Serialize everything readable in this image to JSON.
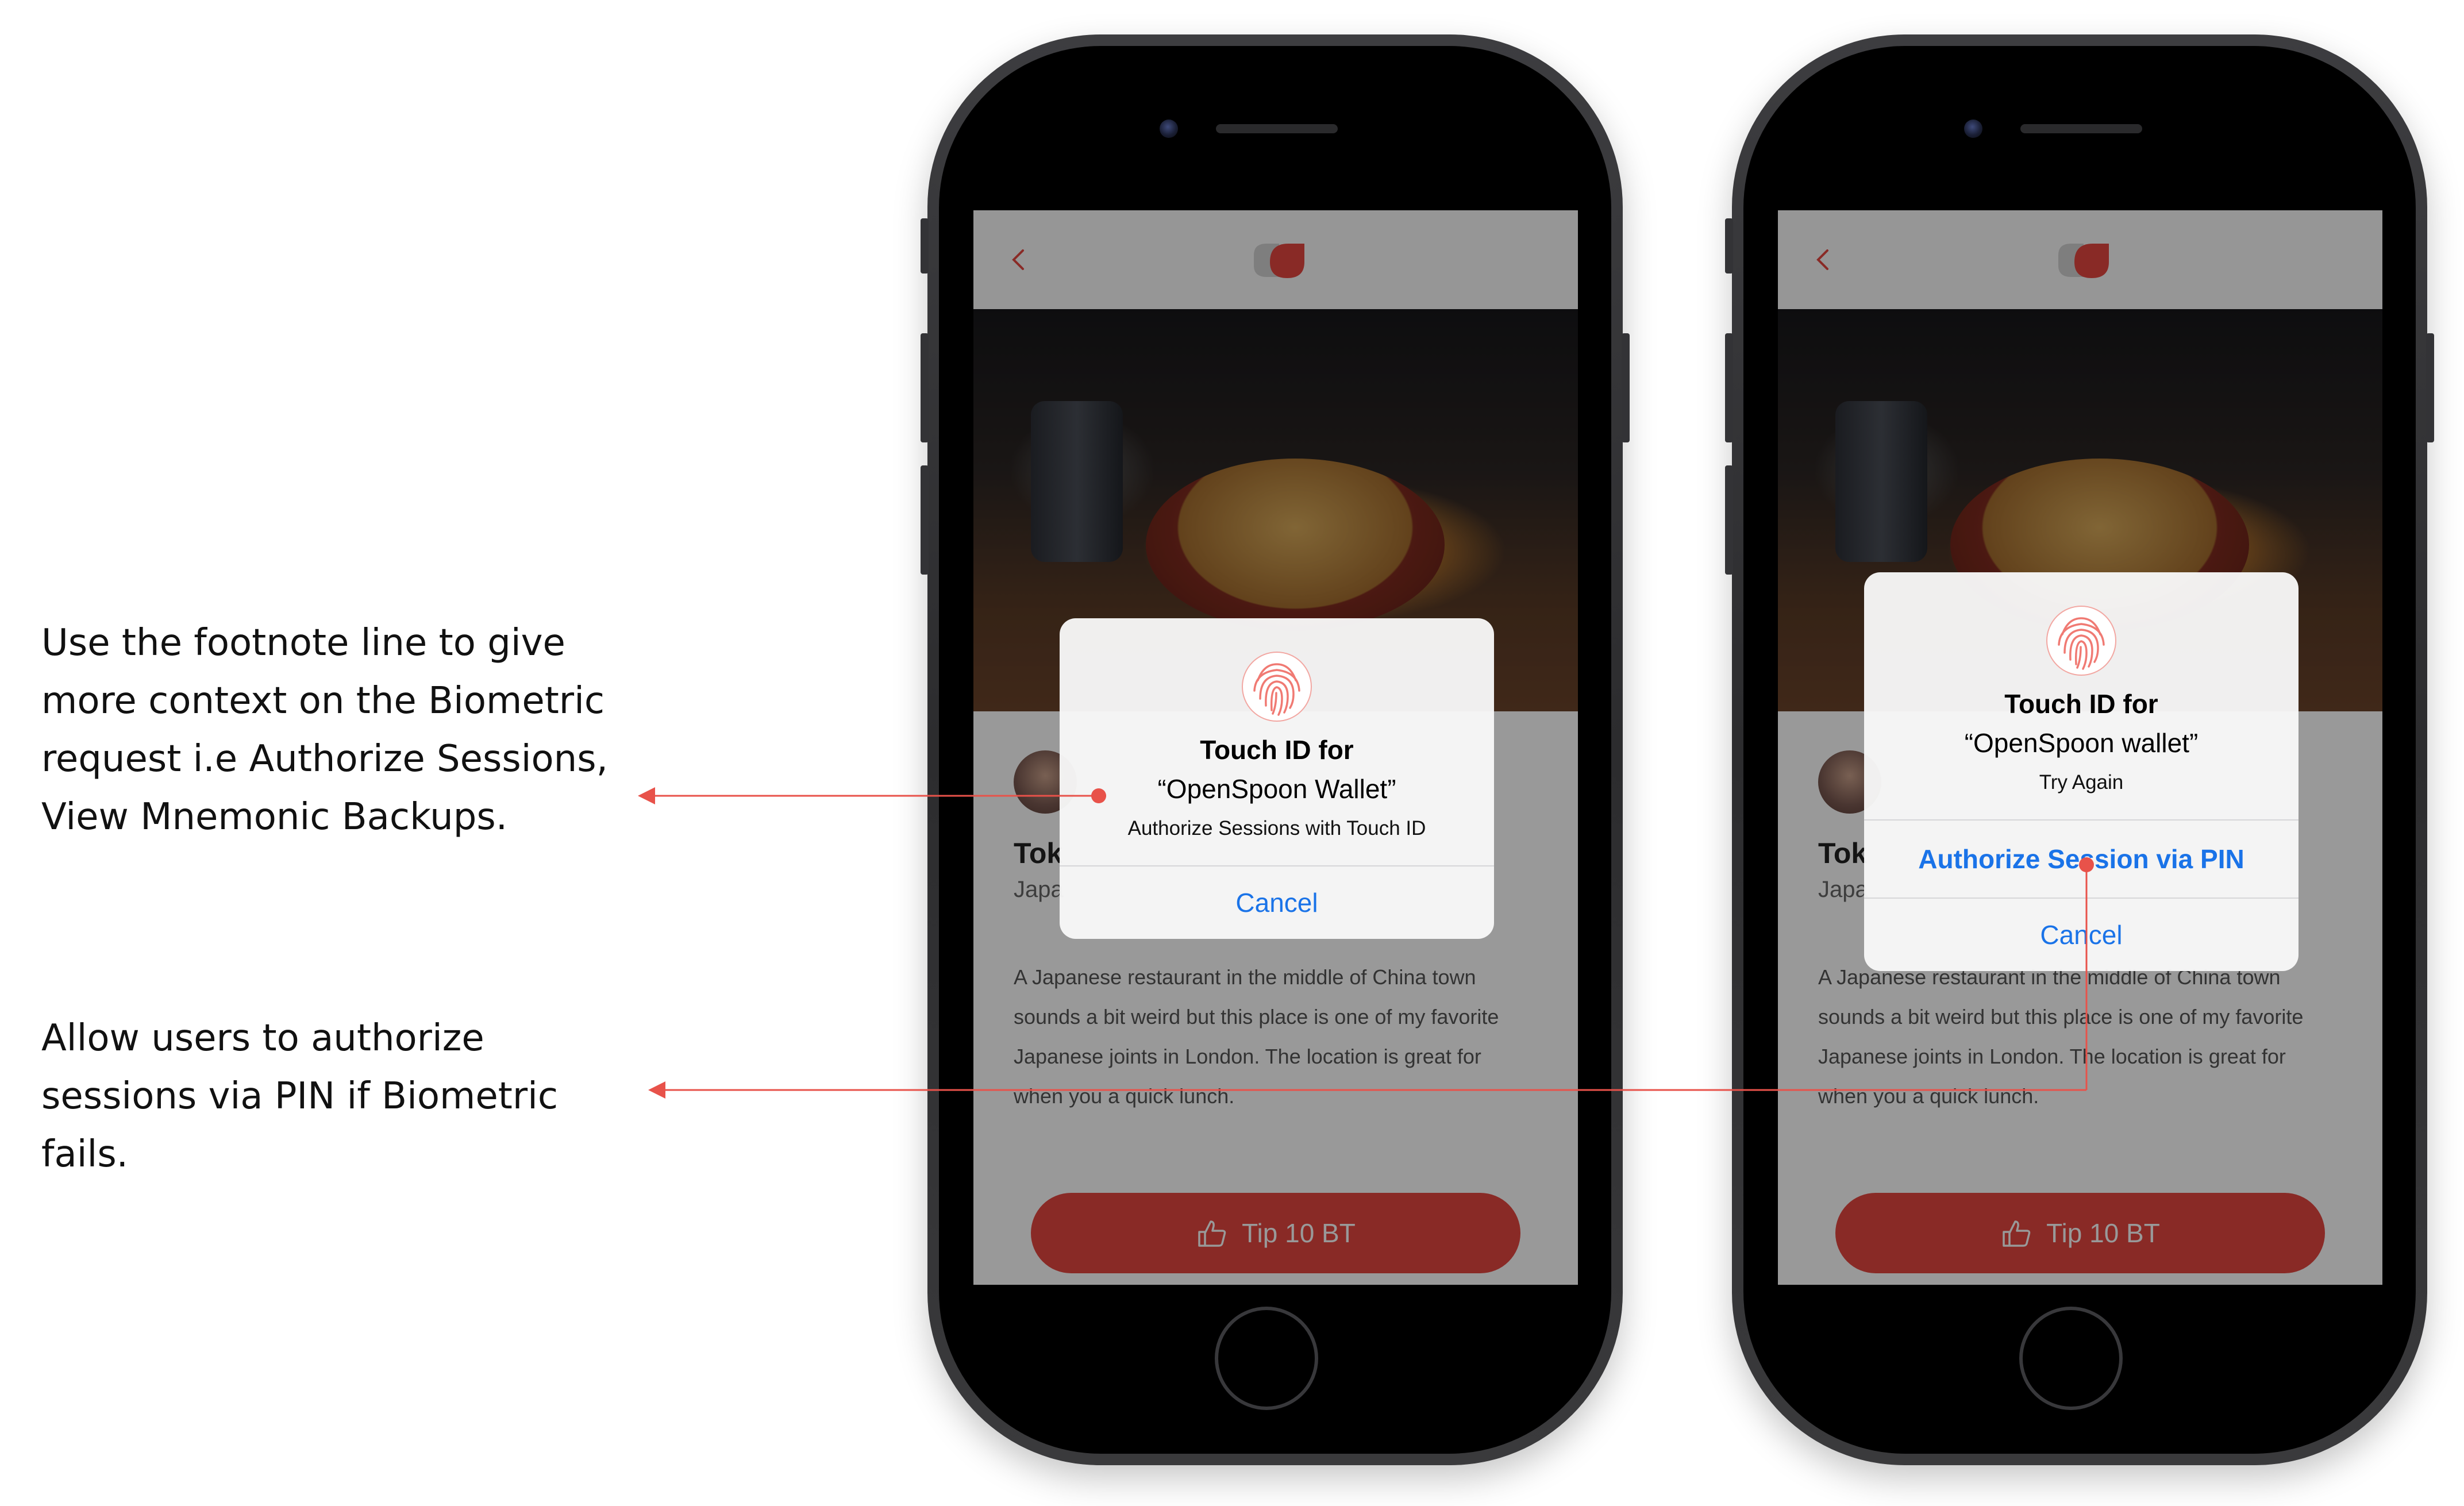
{
  "annotations": [
    "Use the footnote line to give more context on the Biometric request i.e Authorize Sessions, View Mnemonic Backups.",
    "Allow users to authorize sessions via PIN if Biometric fails."
  ],
  "colors": {
    "accent": "#e54640",
    "annotation_line": "#e8524a",
    "link_blue": "#1a73e8"
  },
  "app_screen": {
    "title": "Tok",
    "subtitle": "Japa",
    "description": "A Japanese restaurant in the middle of China town sounds a bit weird but this place is one of my favorite Japanese joints in London. The location is great for when you a quick lunch.",
    "tip_button": "Tip 10 BT"
  },
  "alert_1": {
    "title": "Touch ID for",
    "app_name": "“OpenSpoon Wallet”",
    "footnote": "Authorize Sessions with Touch ID",
    "cancel": "Cancel"
  },
  "alert_2": {
    "title": "Touch ID for",
    "app_name": "“OpenSpoon wallet”",
    "footnote": "Try Again",
    "pin_button": "Authorize Session via PIN",
    "cancel": "Cancel"
  }
}
